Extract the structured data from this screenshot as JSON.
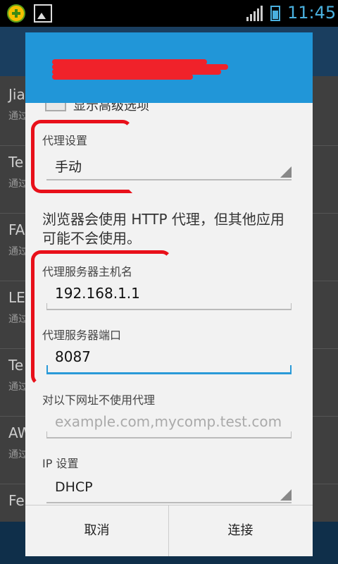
{
  "status_bar": {
    "time": "11:45",
    "icons": [
      "app-plus-icon",
      "gallery-icon",
      "signal-icon",
      "battery-icon"
    ]
  },
  "background_list": {
    "items": [
      {
        "title": "Jia",
        "subtitle": "通过"
      },
      {
        "title": "Te",
        "subtitle": "通过"
      },
      {
        "title": "FA",
        "subtitle": "通过"
      },
      {
        "title": "LE",
        "subtitle": "通过"
      },
      {
        "title": "Te",
        "subtitle": "通过"
      },
      {
        "title": "AW",
        "subtitle": "通过"
      },
      {
        "title": "Fe",
        "subtitle": ""
      }
    ]
  },
  "dialog": {
    "title": "",
    "partial_checkbox_label": "显示高级选项",
    "proxy_label": "代理设置",
    "proxy_value": "手动",
    "info_text": "浏览器会使用 HTTP 代理，但其他应用可能不会使用。",
    "hostname_label": "代理服务器主机名",
    "hostname_value": "192.168.1.1",
    "port_label": "代理服务器端口",
    "port_value": "8087",
    "bypass_label": "对以下网址不使用代理",
    "bypass_placeholder": "example.com,mycomp.test.com",
    "ip_label": "IP 设置",
    "ip_value": "DHCP",
    "cancel_label": "取消",
    "connect_label": "连接"
  },
  "colors": {
    "accent": "#2196d8",
    "annotation": "#e8101a"
  }
}
